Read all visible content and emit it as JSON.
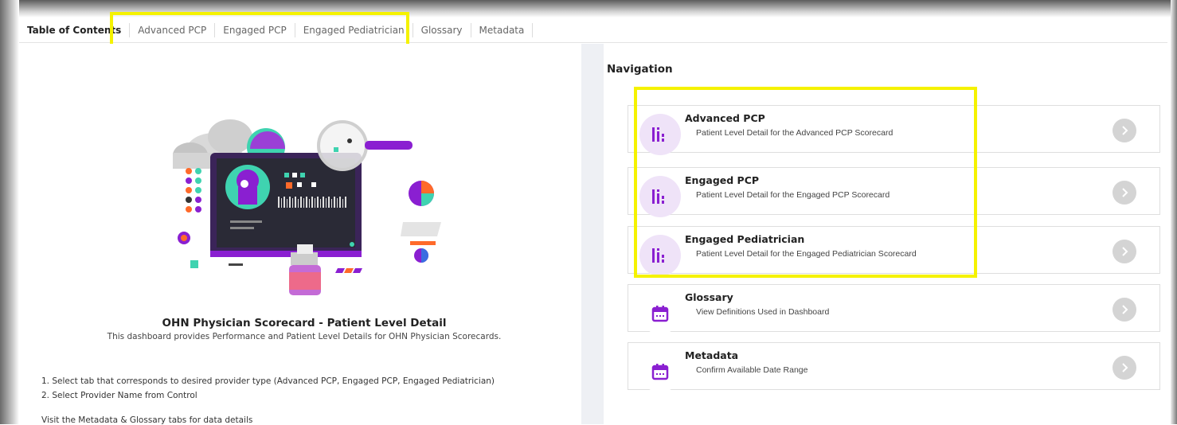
{
  "tabs": [
    "Table of Contents",
    "Advanced PCP",
    "Engaged PCP",
    "Engaged Pediatrician",
    "Glossary",
    "Metadata"
  ],
  "left": {
    "title": "OHN Physician Scorecard - Patient Level Detail",
    "subtitle": "This dashboard provides Performance and Patient Level Details for OHN Physician Scorecards.",
    "instructions": [
      "1. Select tab that corresponds to desired provider type (Advanced PCP, Engaged PCP, Engaged Pediatrician)",
      "2. Select Provider Name from Control",
      "Visit the Metadata & Glossary tabs for data details"
    ]
  },
  "navigation": {
    "heading": "Navigation",
    "cards": [
      {
        "title": "Advanced PCP",
        "description": "Patient Level Detail for the Advanced PCP Scorecard",
        "icon": "bar-chart-icon"
      },
      {
        "title": "Engaged PCP",
        "description": "Patient Level Detail for the Engaged PCP Scorecard",
        "icon": "bar-chart-icon"
      },
      {
        "title": "Engaged Pediatrician",
        "description": "Patient Level Detail for the Engaged Pediatrician Scorecard",
        "icon": "bar-chart-icon"
      },
      {
        "title": "Glossary",
        "description": "View Definitions Used in Dashboard",
        "icon": "calendar-icon"
      },
      {
        "title": "Metadata",
        "description": "Confirm Available Date Range",
        "icon": "calendar-icon"
      }
    ]
  },
  "colors": {
    "accent": "#8a1fd1",
    "icon_bg": "#efe3f8",
    "highlight": "#f5f200",
    "arrow": "#d4d4d4"
  }
}
